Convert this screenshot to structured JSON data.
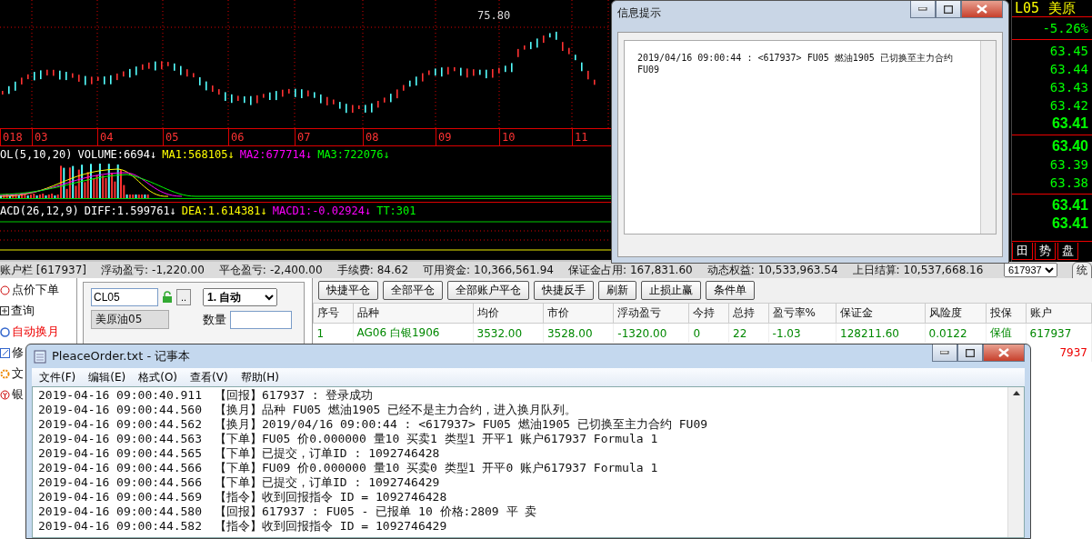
{
  "chart": {
    "peak_label": "75.80",
    "months": [
      "018",
      "03",
      "04",
      "05",
      "06",
      "07",
      "08",
      "09",
      "10",
      "11"
    ],
    "volume_legend": [
      {
        "text": "OL(5,10,20)",
        "color": "#ffffff"
      },
      {
        "text": "VOLUME:6694↓",
        "color": "#ffffff"
      },
      {
        "text": "MA1:568105↓",
        "color": "#ffff00"
      },
      {
        "text": "MA2:677714↓",
        "color": "#ff00ff"
      },
      {
        "text": "MA3:722076↓",
        "color": "#00ff00"
      }
    ],
    "macd_legend": [
      {
        "text": "ACD(26,12,9)",
        "color": "#ffffff"
      },
      {
        "text": "DIFF:1.599761↓",
        "color": "#ffffff"
      },
      {
        "text": "DEA:1.614381↓",
        "color": "#ffff00"
      },
      {
        "text": "MACD1:-0.02924↓",
        "color": "#ff00ff"
      },
      {
        "text": "TT:301",
        "color": "#00ff00"
      }
    ]
  },
  "quote_panel": {
    "code": "L05",
    "name": "美原",
    "change": "-5.26%",
    "asks": [
      {
        "value": "63.45",
        "bold": false
      },
      {
        "value": "63.44",
        "bold": false
      },
      {
        "value": "63.43",
        "bold": false
      },
      {
        "value": "63.42",
        "bold": false
      },
      {
        "value": "63.41",
        "bold": true
      }
    ],
    "bids": [
      {
        "value": "63.40",
        "bold": true
      },
      {
        "value": "63.39",
        "bold": false
      },
      {
        "value": "63.38",
        "bold": false
      }
    ],
    "last": [
      {
        "value": "63.41",
        "bold": true
      },
      {
        "value": "63.41",
        "bold": true
      }
    ],
    "tabs": [
      "田",
      "势",
      "盘"
    ]
  },
  "status_bar": {
    "account": "账户栏 [617937]",
    "items": [
      {
        "label": "浮动盈亏:",
        "value": "-1,220.00"
      },
      {
        "label": "平仓盈亏:",
        "value": "-2,400.00"
      },
      {
        "label": "手续费:",
        "value": "84.62"
      },
      {
        "label": "可用资金:",
        "value": "10,366,561.94"
      },
      {
        "label": "保证金占用:",
        "value": "167,831.60"
      },
      {
        "label": "动态权益:",
        "value": "10,533,963.54"
      },
      {
        "label": "上日结算:",
        "value": "10,537,668.16"
      }
    ],
    "account_select": "617937",
    "button": "统"
  },
  "sidebar": {
    "items": [
      {
        "label": "点价下单",
        "selected": false
      },
      {
        "label": "查询",
        "selected": false
      },
      {
        "label": "自动换月",
        "selected": true
      },
      {
        "label": "修",
        "selected": false
      },
      {
        "label": "文",
        "selected": false
      },
      {
        "label": "银",
        "selected": false
      }
    ]
  },
  "order_form": {
    "code": "CL05",
    "browse": "..",
    "mode": "1. 自动",
    "name": "美原油05",
    "qty_label": "数量"
  },
  "toolbar": [
    "快捷平仓",
    "全部平仓",
    "全部账户平仓",
    "快捷反手",
    "刷新",
    "止损止赢",
    "条件单"
  ],
  "table": {
    "columns": [
      "序号",
      "品种",
      "均价",
      "市价",
      "浮动盈亏",
      "今持",
      "总持",
      "盈亏率%",
      "保证金",
      "风险度",
      "投保",
      "账户"
    ],
    "rows": [
      [
        "1",
        "AG06 白银1906",
        "3532.00",
        "3528.00",
        "-1320.00",
        "0",
        "22",
        "-1.03",
        "128211.60",
        "0.0122",
        "保值",
        "617937"
      ]
    ],
    "partial_row_account": "7937"
  },
  "info_dialog": {
    "title": "信息提示",
    "message": "2019/04/16 09:00:44 : <617937> FU05 燃油1905 已切换至主力合约 FU09"
  },
  "notepad": {
    "title": "PleaceOrder.txt - 记事本",
    "menu": [
      "文件(F)",
      "编辑(E)",
      "格式(O)",
      "查看(V)",
      "帮助(H)"
    ],
    "lines": [
      {
        "time": "2019-04-16 09:00:40.911",
        "text": "【回报】617937 : 登录成功"
      },
      {
        "time": "2019-04-16 09:00:44.560",
        "text": "【换月】品种 FU05 燃油1905 已经不是主力合约，进入换月队列。"
      },
      {
        "time": "2019-04-16 09:00:44.562",
        "text": "【换月】2019/04/16 09:00:44 : <617937> FU05 燃油1905 已切换至主力合约 FU09"
      },
      {
        "time": "2019-04-16 09:00:44.563",
        "text": "【下单】FU05 价0.000000 量10 买卖1 类型1 开平1 账户617937 Formula 1"
      },
      {
        "time": "2019-04-16 09:00:44.565",
        "text": "【下单】已提交，订单ID : 1092746428"
      },
      {
        "time": "2019-04-16 09:00:44.566",
        "text": "【下单】FU09 价0.000000 量10 买卖0 类型1 开平0 账户617937 Formula 1"
      },
      {
        "time": "2019-04-16 09:00:44.566",
        "text": "【下单】已提交，订单ID : 1092746429"
      },
      {
        "time": "2019-04-16 09:00:44.569",
        "text": "【指令】收到回报指令 ID = 1092746428"
      },
      {
        "time": "2019-04-16 09:00:44.580",
        "text": "【回报】617937 : FU05 - 已报单 10 价格:2809 平 卖"
      },
      {
        "time": "2019-04-16 09:00:44.582",
        "text": "【指令】收到回报指令 ID = 1092746429"
      }
    ]
  }
}
